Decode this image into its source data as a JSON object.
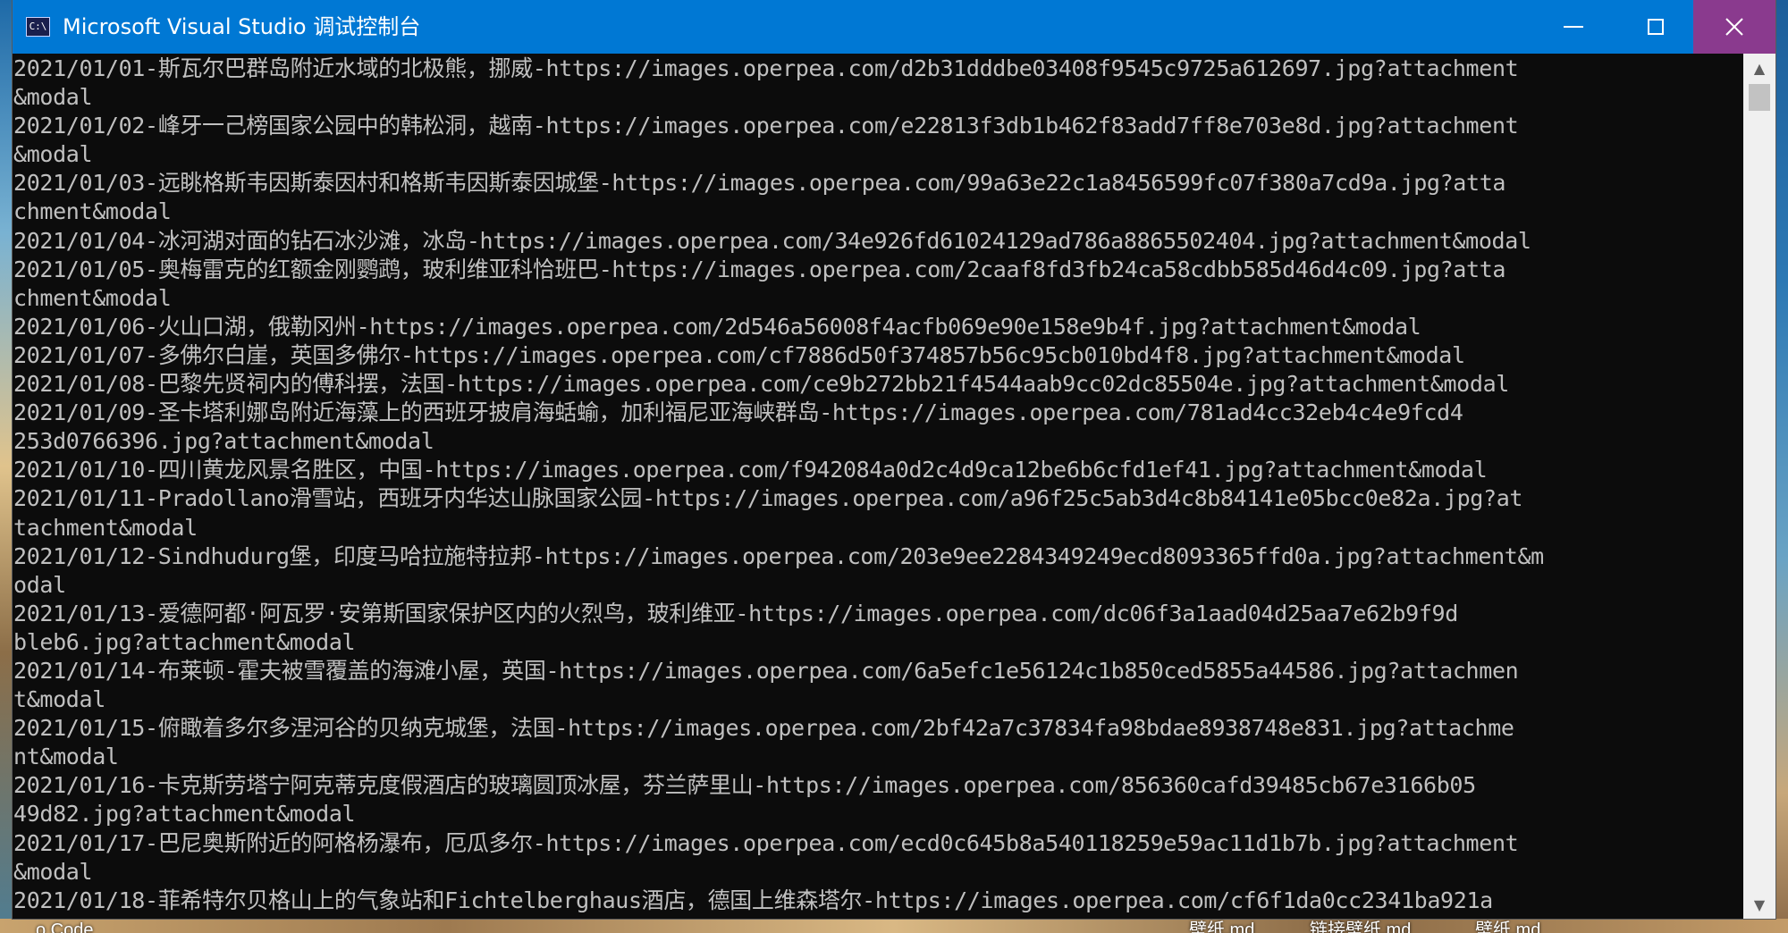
{
  "window": {
    "title": "Microsoft Visual Studio 调试控制台",
    "icon_text": "C:\\"
  },
  "console": {
    "lines": [
      "2021/01/01-斯瓦尔巴群岛附近水域的北极熊，挪威-https://images.operpea.com/d2b31dddbe03408f9545c9725a612697.jpg?attachment",
      "&modal",
      "2021/01/02-峰牙一己榜国家公园中的韩松洞，越南-https://images.operpea.com/e22813f3db1b462f83add7ff8e703e8d.jpg?attachment",
      "&modal",
      "2021/01/03-远眺格斯韦因斯泰因村和格斯韦因斯泰因城堡-https://images.operpea.com/99a63e22c1a8456599fc07f380a7cd9a.jpg?atta",
      "chment&modal",
      "2021/01/04-冰河湖对面的钻石冰沙滩，冰岛-https://images.operpea.com/34e926fd61024129ad786a8865502404.jpg?attachment&modal",
      "2021/01/05-奥梅雷克的红额金刚鹦鹉，玻利维亚科恰班巴-https://images.operpea.com/2caaf8fd3fb24ca58cdbb585d46d4c09.jpg?atta",
      "chment&modal",
      "2021/01/06-火山口湖，俄勒冈州-https://images.operpea.com/2d546a56008f4acfb069e90e158e9b4f.jpg?attachment&modal",
      "2021/01/07-多佛尔白崖，英国多佛尔-https://images.operpea.com/cf7886d50f374857b56c95cb010bd4f8.jpg?attachment&modal",
      "2021/01/08-巴黎先贤祠内的傅科摆，法国-https://images.operpea.com/ce9b272bb21f4544aab9cc02dc85504e.jpg?attachment&modal",
      "2021/01/09-圣卡塔利娜岛附近海藻上的西班牙披肩海蛞蝓，加利福尼亚海峡群岛-https://images.operpea.com/781ad4cc32eb4c4e9fcd4",
      "253d0766396.jpg?attachment&modal",
      "2021/01/10-四川黄龙风景名胜区，中国-https://images.operpea.com/f942084a0d2c4d9ca12be6b6cfd1ef41.jpg?attachment&modal",
      "2021/01/11-Pradollano滑雪站，西班牙内华达山脉国家公园-https://images.operpea.com/a96f25c5ab3d4c8b84141e05bcc0e82a.jpg?at",
      "tachment&modal",
      "2021/01/12-Sindhudurg堡，印度马哈拉施特拉邦-https://images.operpea.com/203e9ee2284349249ecd8093365ffd0a.jpg?attachment&m",
      "odal",
      "2021/01/13-爱德阿都·阿瓦罗·安第斯国家保护区内的火烈鸟，玻利维亚-https://images.operpea.com/dc06f3a1aad04d25aa7e62b9f9d",
      "bleb6.jpg?attachment&modal",
      "2021/01/14-布莱顿-霍夫被雪覆盖的海滩小屋，英国-https://images.operpea.com/6a5efc1e56124c1b850ced5855a44586.jpg?attachmen",
      "t&modal",
      "2021/01/15-俯瞰着多尔多涅河谷的贝纳克城堡，法国-https://images.operpea.com/2bf42a7c37834fa98bdae8938748e831.jpg?attachme",
      "nt&modal",
      "2021/01/16-卡克斯劳塔宁阿克蒂克度假酒店的玻璃圆顶冰屋，芬兰萨里山-https://images.operpea.com/856360cafd39485cb67e3166b05",
      "49d82.jpg?attachment&modal",
      "2021/01/17-巴尼奥斯附近的阿格杨瀑布，厄瓜多尔-https://images.operpea.com/ecd0c645b8a540118259e59ac11d1b7b.jpg?attachment",
      "&modal",
      "2021/01/18-菲希特尔贝格山上的气象站和Fichtelberghaus酒店，德国上维森塔尔-https://images.operpea.com/cf6f1da0cc2341ba921a"
    ]
  },
  "desktop": {
    "items": [
      {
        "label": "o Code"
      },
      {
        "label": "壁纸.md"
      },
      {
        "label": "链接壁纸.md"
      },
      {
        "label": "壁纸.md"
      }
    ]
  },
  "colors": {
    "title_bar": "#0078d4",
    "close_hover": "#8a3a8e",
    "console_bg": "#0c0c0c",
    "console_fg": "#c0c0c0"
  },
  "icons": {
    "minimize": "minimize-icon",
    "maximize": "maximize-icon",
    "close": "close-icon",
    "scroll_up": "chevron-up-icon",
    "scroll_down": "chevron-down-icon"
  }
}
